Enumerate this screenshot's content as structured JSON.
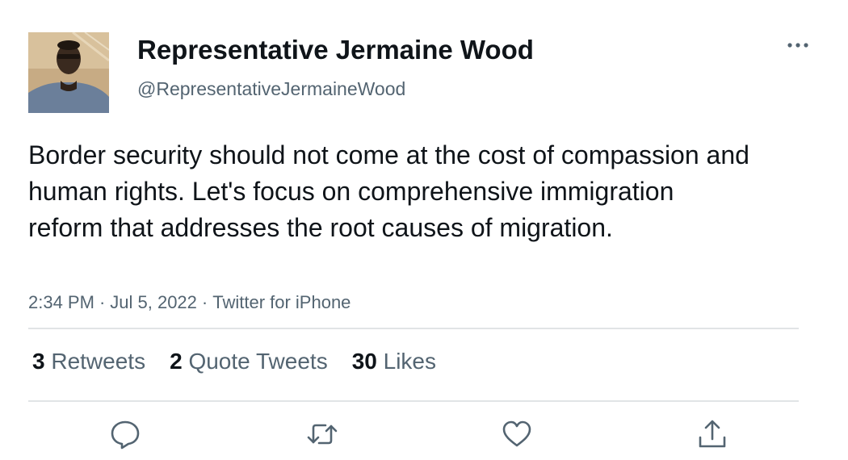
{
  "author": {
    "display_name": "Representative Jermaine Wood",
    "handle": "@RepresentativeJermaineWood"
  },
  "tweet": {
    "text": "Border security should not come at the cost of compassion and human rights. Let's focus on comprehensive immigration reform that addresses the root causes of migration."
  },
  "meta": {
    "time": "2:34 PM",
    "date": "Jul 5, 2022",
    "source": "Twitter for iPhone",
    "separator": "·"
  },
  "stats": {
    "retweets": {
      "count": "3",
      "label": "Retweets"
    },
    "quote_tweets": {
      "count": "2",
      "label": "Quote Tweets"
    },
    "likes": {
      "count": "30",
      "label": "Likes"
    }
  },
  "icons": {
    "more": "more-horizontal-icon",
    "reply": "reply-icon",
    "retweet": "retweet-icon",
    "like": "heart-icon",
    "share": "share-icon"
  },
  "colors": {
    "text_primary": "#0f1419",
    "text_secondary": "#536471",
    "divider": "#e1e4e6",
    "icon": "#536471"
  }
}
